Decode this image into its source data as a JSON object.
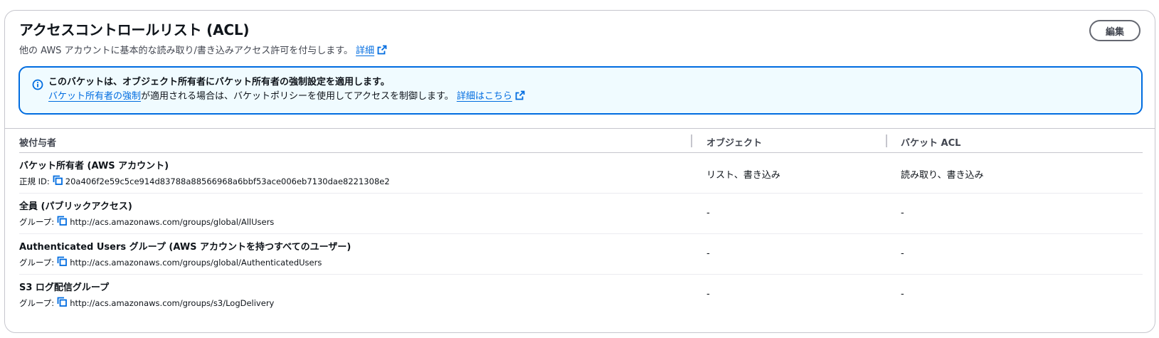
{
  "header": {
    "title": "アクセスコントロールリスト (ACL)",
    "description": "他の AWS アカウントに基本的な読み取り/書き込みアクセス許可を付与します。",
    "detail_link": "詳細",
    "edit_button": "編集"
  },
  "alert": {
    "title": "このバケットは、オブジェクト所有者にバケット所有者の強制設定を適用します。",
    "body_link": "バケット所有者の強制",
    "body_text": "が適用される場合は、バケットポリシーを使用してアクセスを制御します。",
    "detail_link": "詳細はこちら"
  },
  "table": {
    "columns": [
      "被付与者",
      "オブジェクト",
      "バケット ACL"
    ],
    "rows": [
      {
        "name": "バケット所有者 (AWS アカウント)",
        "sub_label": "正規 ID:",
        "sub_value": "20a406f2e59c5ce914d83788a88566968a6bbf53ace006eb7130dae8221308e2",
        "object": "リスト、書き込み",
        "bucket_acl": "読み取り、書き込み"
      },
      {
        "name": "全員 (パブリックアクセス)",
        "sub_label": "グループ:",
        "sub_value": "http://acs.amazonaws.com/groups/global/AllUsers",
        "object": "-",
        "bucket_acl": "-"
      },
      {
        "name": "Authenticated Users グループ (AWS アカウントを持つすべてのユーザー)",
        "sub_label": "グループ:",
        "sub_value": "http://acs.amazonaws.com/groups/global/AuthenticatedUsers",
        "object": "-",
        "bucket_acl": "-"
      },
      {
        "name": "S3 ログ配信グループ",
        "sub_label": "グループ:",
        "sub_value": "http://acs.amazonaws.com/groups/s3/LogDelivery",
        "object": "-",
        "bucket_acl": "-"
      }
    ]
  },
  "colors": {
    "link": "#006ce0",
    "alert_border": "#006ce0",
    "alert_bg": "#f0fbff",
    "text": "#0f141a",
    "border": "#c6c6cd"
  },
  "icons": [
    "external-link-icon",
    "info-icon",
    "copy-icon"
  ]
}
